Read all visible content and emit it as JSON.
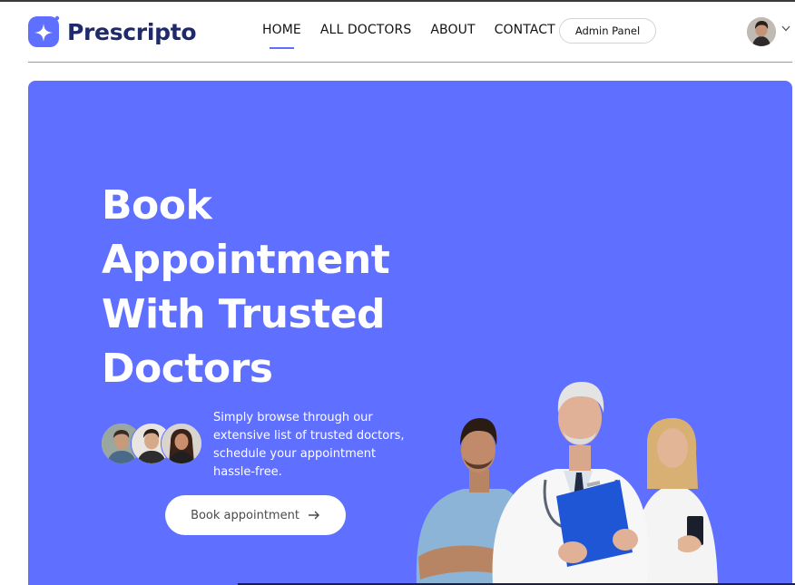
{
  "brand": {
    "name": "Prescripto",
    "accent": "#5f6fff",
    "logo_color": "#5f6fff"
  },
  "nav": {
    "items": [
      {
        "label": "HOME",
        "active": true
      },
      {
        "label": "ALL DOCTORS",
        "active": false
      },
      {
        "label": "ABOUT",
        "active": false
      },
      {
        "label": "CONTACT",
        "active": false
      }
    ],
    "admin_label": "Admin Panel"
  },
  "user": {
    "avatar_icon": "user-avatar",
    "menu_icon": "chevron-down-icon"
  },
  "hero": {
    "title_lines": [
      "Book",
      "Appointment",
      "With Trusted",
      "Doctors"
    ],
    "subtitle": "Simply browse through our extensive list of trusted doctors, schedule your appointment hassle-free.",
    "cta_label": "Book appointment",
    "cta_icon": "arrow-right-icon",
    "background": "#5f6fff"
  }
}
